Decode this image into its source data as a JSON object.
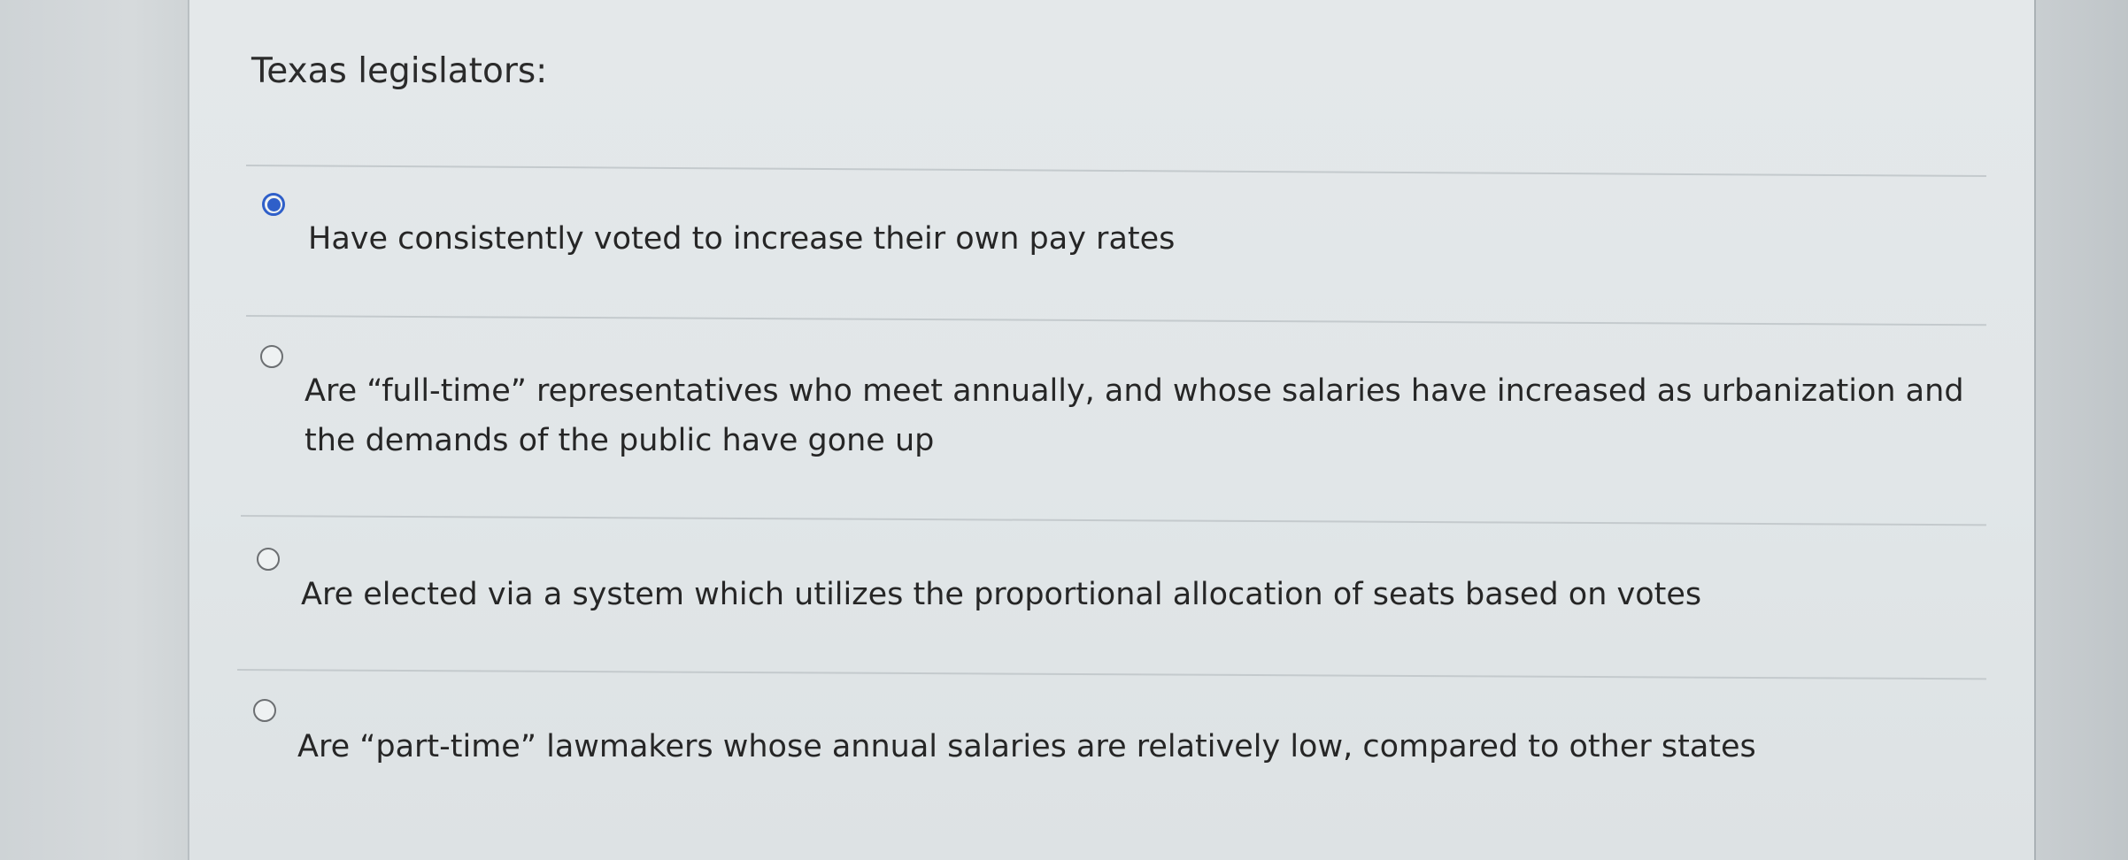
{
  "question": {
    "prompt": "Texas legislators:"
  },
  "choices": [
    {
      "label": "Have consistently voted to increase their own pay rates",
      "selected": true
    },
    {
      "label_line1": "Are “full-time” representatives who meet annually, and whose salaries have increased as urbanization and",
      "label_line2": "the demands of the public have gone up",
      "selected": false
    },
    {
      "label": "Are elected via a system which utilizes the proportional allocation of seats based on votes",
      "selected": false
    },
    {
      "label": "Are “part-time” lawmakers whose annual salaries are relatively low, compared to other states",
      "selected": false
    }
  ],
  "colors": {
    "accent": "#2f5fc9",
    "text": "#262626",
    "card_background": "#e2e7e9"
  },
  "icons": {
    "selected_choice": "radio-selected-icon",
    "unselected_choice": "radio-unselected-icon"
  }
}
